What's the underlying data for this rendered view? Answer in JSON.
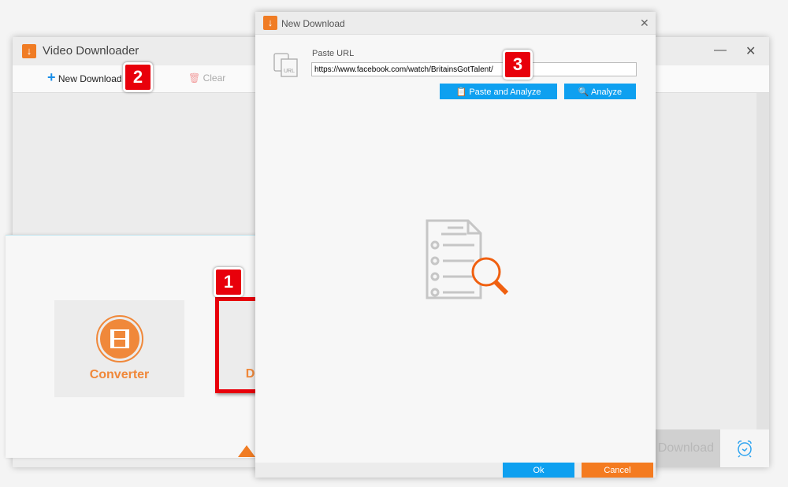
{
  "main_window": {
    "title": "Video Downloader",
    "new_download": "New Download",
    "clear": "Clear",
    "download_all": "Download All",
    "minimize": "—",
    "close": "✕"
  },
  "launcher": {
    "converter": "Converter",
    "downloader": "Downloader"
  },
  "badges": [
    "1",
    "2",
    "3"
  ],
  "dialog": {
    "title": "New Download",
    "close": "✕",
    "paste_url_label": "Paste URL",
    "url_value": "https://www.facebook.com/watch/BritainsGotTalent/",
    "paste_analyze": "Paste and Analyze",
    "analyze": "Analyze",
    "ok": "Ok",
    "cancel": "Cancel",
    "url_icon_text": "URL"
  },
  "colors": {
    "accent_orange": "#f47b20",
    "accent_blue": "#0ea0f0",
    "badge_red": "#e8000b"
  }
}
